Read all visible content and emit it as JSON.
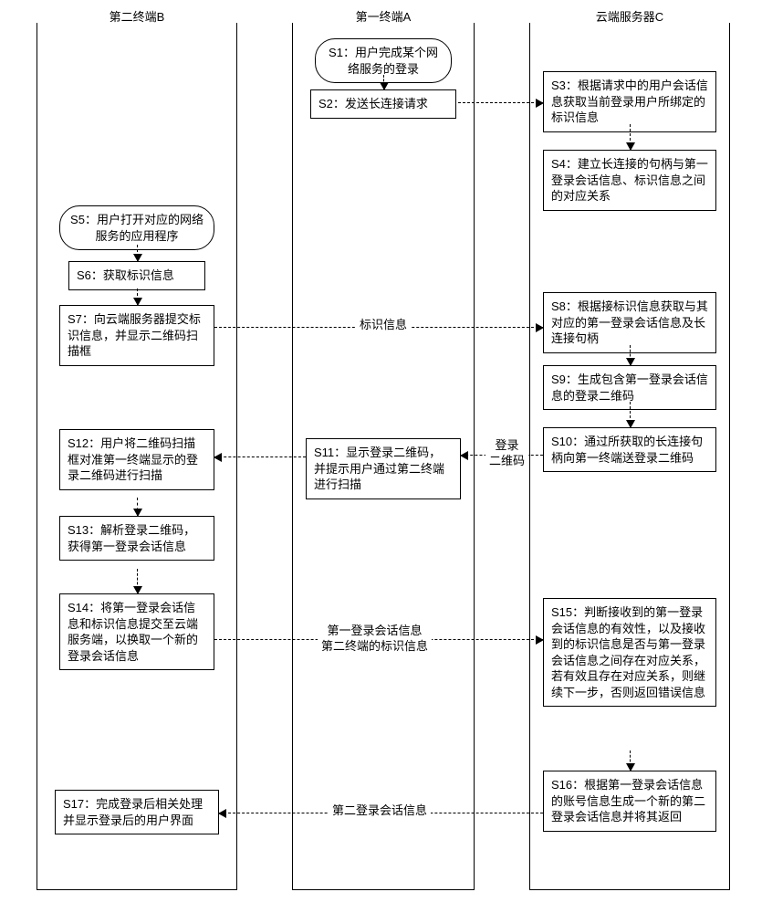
{
  "lanes": {
    "b": {
      "title": "第二终端B"
    },
    "a": {
      "title": "第一终端A"
    },
    "c": {
      "title": "云端服务器C"
    }
  },
  "nodes": {
    "s1": "S1：用户完成某个网络服务的登录",
    "s2": "S2：发送长连接请求",
    "s3": "S3：根据请求中的用户会话信息获取当前登录用户所绑定的标识信息",
    "s4": "S4：建立长连接的句柄与第一登录会话信息、标识信息之间的对应关系",
    "s5": "S5：用户打开对应的网络服务的应用程序",
    "s6": "S6：获取标识信息",
    "s7": "S7：向云端服务器提交标识信息，并显示二维码扫描框",
    "s8": "S8：根据接标识信息获取与其对应的第一登录会话信息及长连接句柄",
    "s9": "S9：生成包含第一登录会话信息的登录二维码",
    "s10": "S10：通过所获取的长连接句柄向第一终端送登录二维码",
    "s11": "S11：显示登录二维码，并提示用户通过第二终端进行扫描",
    "s12": "S12：用户将二维码扫描框对准第一终端显示的登录二维码进行扫描",
    "s13": "S13：解析登录二维码，获得第一登录会话信息",
    "s14": "S14：将第一登录会话信息和标识信息提交至云端服务端，以换取一个新的登录会话信息",
    "s15": "S15：判断接收到的第一登录会话信息的有效性，以及接收到的标识信息是否与第一登录会话信息之间存在对应关系，若有效且存在对应关系，则继续下一步，否则返回错误信息",
    "s16": "S16：根据第一登录会话信息的账号信息生成一个新的第二登录会话信息并将其返回",
    "s17": "S17：完成登录后相关处理并显示登录后的用户界面"
  },
  "arrows": {
    "a2c_1": "",
    "b2c_1": "标识信息",
    "c2a_1": "登录\n二维码",
    "a2b_1": "",
    "b2c_2": "第一登录会话信息\n第二终端的标识信息",
    "c2b_1": "第二登录会话信息"
  }
}
